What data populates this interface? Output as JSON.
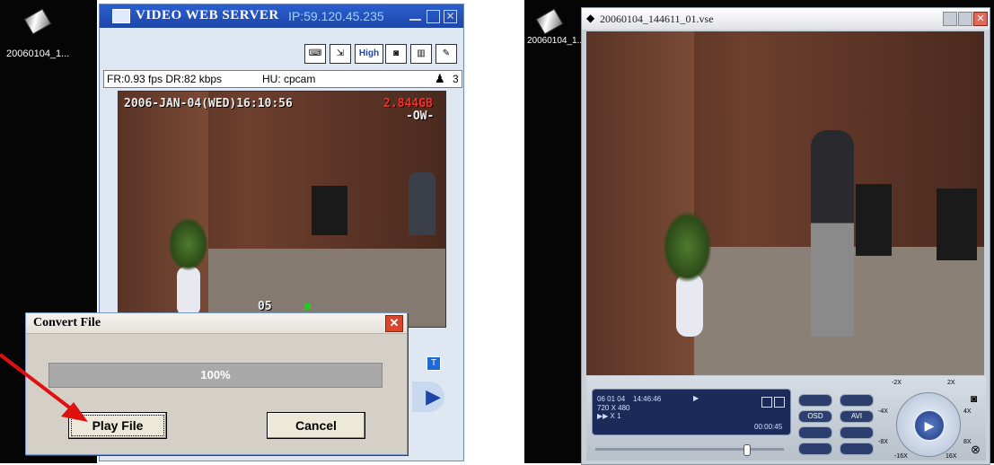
{
  "left": {
    "desktop_icon_label": "20060104_1...",
    "window": {
      "title": "Video Web Server",
      "ip": "IP:59.120.45.235",
      "toolbar": {
        "high_label": "High"
      },
      "status": {
        "fr_dr": "FR:0.93 fps DR:82 kbps",
        "hu": "HU: cpcam",
        "user_count": "3"
      },
      "osd": {
        "datetime": "2006-JAN-04(WED)16:10:56",
        "storage": "2.844GB",
        "ow": "-OW-",
        "channel": "05"
      },
      "side_t_label": "T"
    },
    "dialog": {
      "title": "Convert File",
      "progress": 100,
      "progress_text": "100%",
      "play_label": "Play File",
      "cancel_label": "Cancel"
    }
  },
  "right": {
    "desktop_icon_label": "20060104_1...",
    "player": {
      "title": "20060104_144611_01.vse",
      "info_date": "06 01 04",
      "info_time": "14:46:46",
      "resolution": "720 X 480",
      "speed": "▶▶ X 1",
      "elapsed": "00:00:45",
      "btn_osd": "OSD",
      "btn_avi": "AVI",
      "speed_labels": {
        "m2x": "-2X",
        "p2x": "2X",
        "m4x": "-4X",
        "p4x": "4X",
        "m8x": "-8X",
        "p8x": "8X",
        "m16x": "-16X",
        "p16x": "16X"
      }
    }
  },
  "colors": {
    "title_blue": "#1c46a8",
    "dialog_close": "#d9452b",
    "arrow_red": "#e01010"
  }
}
